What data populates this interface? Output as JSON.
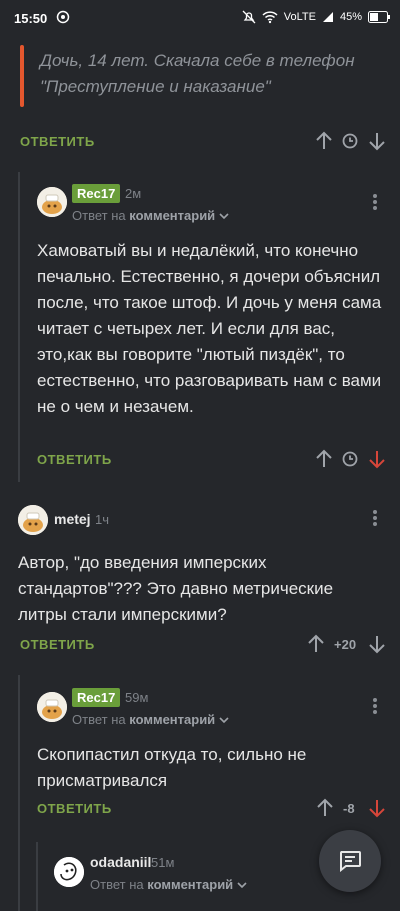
{
  "status_bar": {
    "time": "15:50",
    "network": "VoLTE",
    "battery": "45%"
  },
  "quote": {
    "text": "Дочь, 14 лет. Скачала себе в телефон \"Преступление и наказание\""
  },
  "actions": {
    "reply": "ОТВЕТИТЬ"
  },
  "comments": [
    {
      "user": "Rec17",
      "time": "2м",
      "reply_prefix": "Ответ на",
      "reply_target": "комментарий",
      "text": "Хамоватый вы и недалёкий, что конечно печально. Естественно, я дочери объяснил после, что такое штоф. И дочь у меня сама читает с четырех лет. И если для вас, это,как вы говорите \"лютый пиздёк\", то естественно, что разговаривать нам с вами не о чем и незачем."
    },
    {
      "user": "metej",
      "time": "1ч",
      "text": "Автор, \"до введения имперских стандартов\"??? Это давно метрические литры стали имперскими?",
      "score": "+20"
    },
    {
      "user": "Rec17",
      "time": "59м",
      "reply_prefix": "Ответ на",
      "reply_target": "комментарий",
      "text": "Скопипастил откуда то, сильно не присматривался",
      "score": "-8"
    },
    {
      "user": "odadaniil",
      "time": "51м",
      "reply_prefix": "Ответ на",
      "reply_target": "комментарий"
    }
  ],
  "colors": {
    "accent_green": "#7fa54a",
    "badge_green": "#6a9e3a",
    "downvote_red": "#d6463a",
    "quote_bar": "#e4572e"
  },
  "icons": [
    "arrow-up-icon",
    "clock-icon",
    "arrow-down-icon",
    "more-vertical-icon",
    "chevron-down-icon",
    "chat-icon"
  ]
}
